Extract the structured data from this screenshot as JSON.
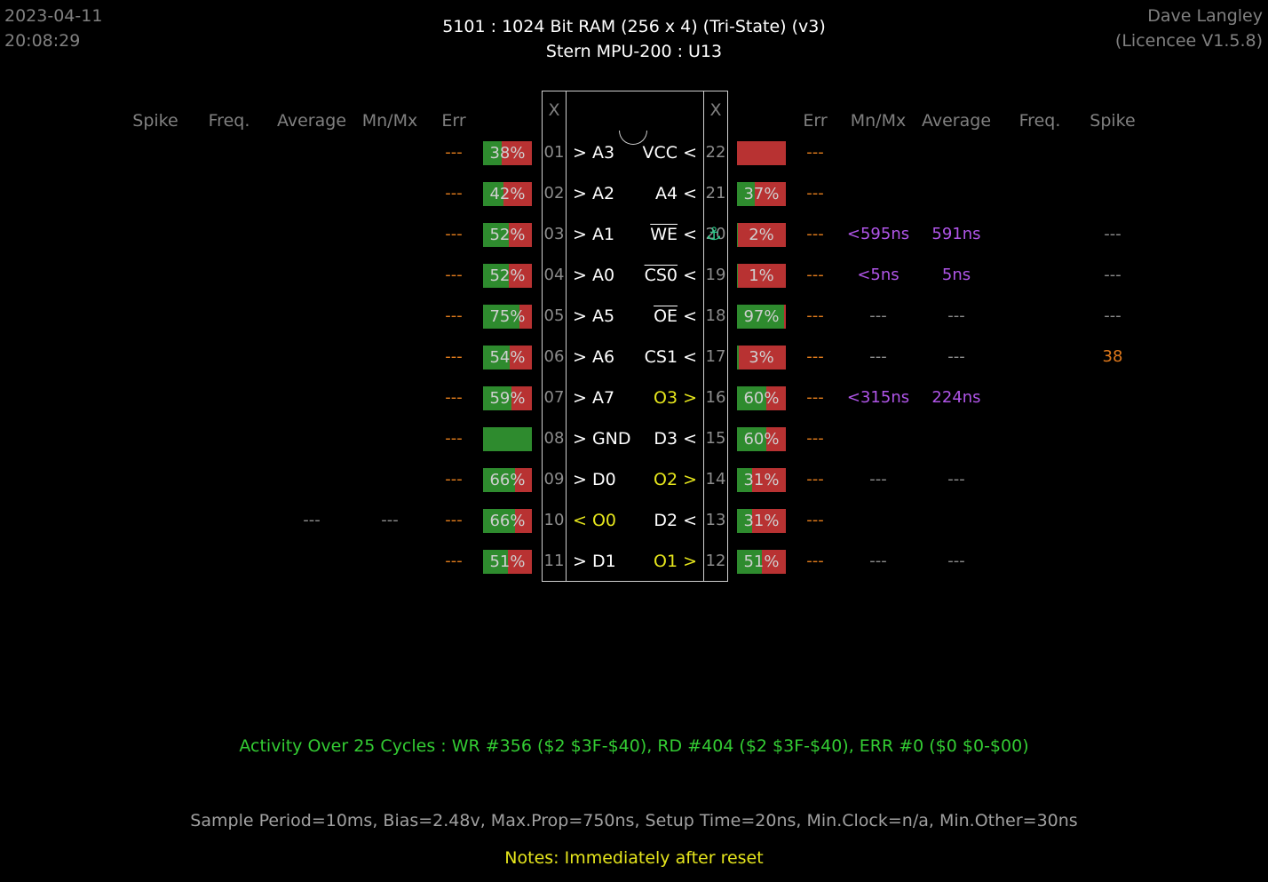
{
  "header": {
    "date": "2023-04-11",
    "time": "20:08:29",
    "title": "5101  :  1024 Bit RAM (256 x 4) (Tri-State) (v3)",
    "subtitle": "Stern MPU-200 : U13",
    "user": "Dave Langley",
    "licence": "(Licencee V1.5.8)"
  },
  "columns": {
    "left": [
      "Spike",
      "Freq.",
      "Average",
      "Mn/Mx",
      "Err"
    ],
    "right": [
      "Err",
      "Mn/Mx",
      "Average",
      "Freq.",
      "Spike"
    ],
    "x_left": "X",
    "x_right": "X"
  },
  "left_pins": [
    {
      "num": "01",
      "name": "> A3",
      "err": "---",
      "bar": 38,
      "bar_label": "38%"
    },
    {
      "num": "02",
      "name": "> A2",
      "err": "---",
      "bar": 42,
      "bar_label": "42%"
    },
    {
      "num": "03",
      "name": "> A1",
      "err": "---",
      "bar": 52,
      "bar_label": "52%"
    },
    {
      "num": "04",
      "name": "> A0",
      "err": "---",
      "bar": 52,
      "bar_label": "52%"
    },
    {
      "num": "05",
      "name": "> A5",
      "err": "---",
      "bar": 75,
      "bar_label": "75%"
    },
    {
      "num": "06",
      "name": "> A6",
      "err": "---",
      "bar": 54,
      "bar_label": "54%"
    },
    {
      "num": "07",
      "name": "> A7",
      "err": "---",
      "bar": 59,
      "bar_label": "59%"
    },
    {
      "num": "08",
      "name": "> GND",
      "err": "---",
      "bar": 100,
      "bar_label": ""
    },
    {
      "num": "09",
      "name": "> D0",
      "err": "---",
      "bar": 66,
      "bar_label": "66%"
    },
    {
      "num": "10",
      "name": "< O0",
      "err": "---",
      "bar": 66,
      "bar_label": "66%",
      "avg": "---",
      "mnmx": "---"
    },
    {
      "num": "11",
      "name": "> D1",
      "err": "---",
      "bar": 51,
      "bar_label": "51%"
    }
  ],
  "right_pins": [
    {
      "num": "22",
      "name": "VCC <",
      "err": "---",
      "bar": 0,
      "bar_label": ""
    },
    {
      "num": "21",
      "name": "A4 <",
      "err": "---",
      "bar": 37,
      "bar_label": "37%"
    },
    {
      "num": "20",
      "name": "WE <",
      "err": "---",
      "bar": 2,
      "bar_label": "2%",
      "mnmx": "<595ns",
      "avg": "591ns",
      "spike": "---"
    },
    {
      "num": "19",
      "name": "CS0 <",
      "err": "---",
      "bar": 1,
      "bar_label": "1%",
      "mnmx": "<5ns",
      "avg": "5ns",
      "spike": "---"
    },
    {
      "num": "18",
      "name": "OE <",
      "err": "---",
      "bar": 97,
      "bar_label": "97%",
      "mnmx": "---",
      "avg": "---",
      "spike": "---"
    },
    {
      "num": "17",
      "name": "CS1 <",
      "err": "---",
      "bar": 3,
      "bar_label": "3%",
      "mnmx": "---",
      "avg": "---",
      "spike": "38"
    },
    {
      "num": "16",
      "name": "O3 >",
      "err": "---",
      "bar": 60,
      "bar_label": "60%",
      "mnmx": "<315ns",
      "avg": "224ns"
    },
    {
      "num": "15",
      "name": "D3 <",
      "err": "---",
      "bar": 60,
      "bar_label": "60%"
    },
    {
      "num": "14",
      "name": "O2 >",
      "err": "---",
      "bar": 31,
      "bar_label": "31%",
      "mnmx": "---",
      "avg": "---"
    },
    {
      "num": "13",
      "name": "D2 <",
      "err": "---",
      "bar": 31,
      "bar_label": "31%"
    },
    {
      "num": "12",
      "name": "O1 >",
      "err": "---",
      "bar": 51,
      "bar_label": "51%",
      "mnmx": "---",
      "avg": "---"
    }
  ],
  "footer": {
    "activity": "Activity Over 25 Cycles  :  WR #356 ($2  $3F-$40),  RD #404 ($2  $3F-$40),  ERR #0 ($0  $0-$00)",
    "sample": "Sample Period=10ms,  Bias=2.48v,  Max.Prop=750ns,  Setup Time=20ns,  Min.Clock=n/a,  Min.Other=30ns",
    "notes": "Notes:  Immediately after reset"
  },
  "colors": {
    "bar_green": "#2e8b2e",
    "bar_red": "#b83232",
    "err_orange": "#e07b1c",
    "timing_purple": "#b055e8",
    "output_yellow": "#e6e61c",
    "activity_green": "#33cc33"
  },
  "icons": {
    "trigger_flag": "flag-icon"
  }
}
